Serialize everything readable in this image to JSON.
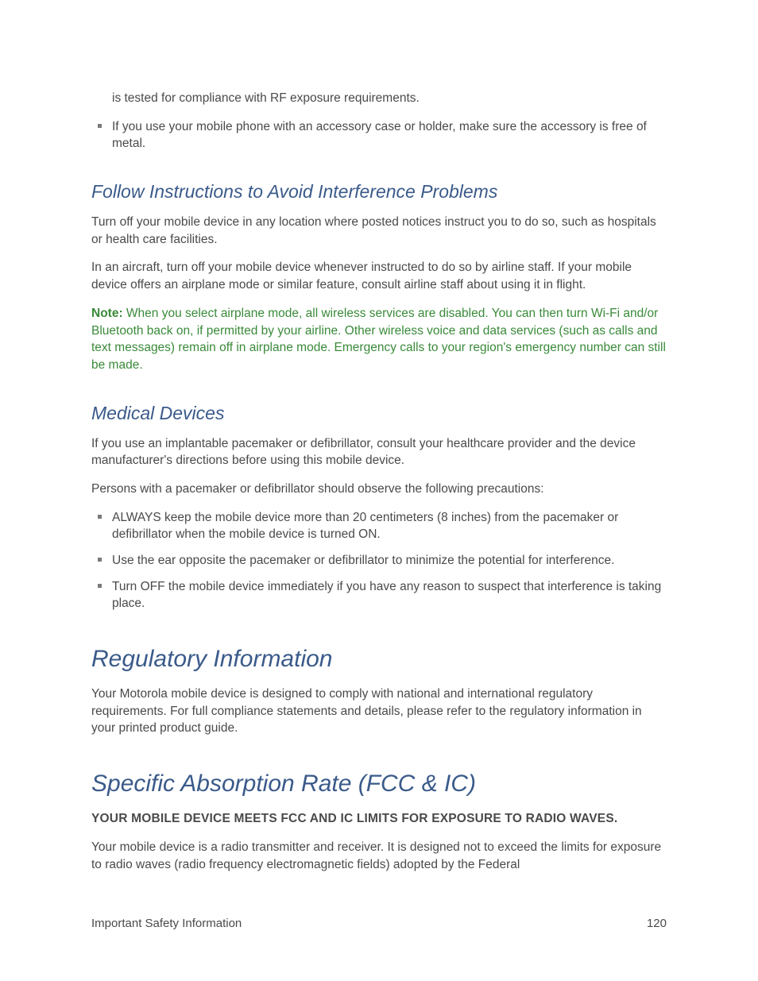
{
  "intro": {
    "continued_line": "is tested for compliance with RF exposure requirements.",
    "bullet1": "If you use your mobile phone with an accessory case or holder, make sure the accessory is free of metal."
  },
  "section1": {
    "heading": "Follow Instructions to Avoid Interference Problems",
    "p1": "Turn off your mobile device in any location where posted notices instruct you to do so, such as hospitals or health care facilities.",
    "p2": "In an aircraft, turn off your mobile device whenever instructed to do so by airline staff. If your mobile device offers an airplane mode or similar feature, consult airline staff about using it in flight.",
    "note_label": "Note:",
    "note_text": "When you select airplane mode, all wireless services are disabled. You can then turn Wi-Fi and/or Bluetooth back on, if permitted by your airline. Other wireless voice and data services (such as calls and text messages) remain off in airplane mode. Emergency calls to your region's emergency number can still be made."
  },
  "section2": {
    "heading": "Medical Devices",
    "p1": "If you use an implantable pacemaker or defibrillator, consult your healthcare provider and the device manufacturer's directions before using this mobile device.",
    "p2": "Persons with a pacemaker or defibrillator should observe the following precautions:",
    "bullets": [
      "ALWAYS keep the mobile device more than 20 centimeters (8 inches) from the pacemaker or defibrillator when the mobile device is turned ON.",
      "Use the ear opposite the pacemaker or defibrillator to minimize the potential for interference.",
      "Turn OFF the mobile device immediately if you have any reason to suspect that interference is taking place."
    ]
  },
  "section3": {
    "heading": "Regulatory Information",
    "p1": "Your Motorola mobile device is designed to comply with national and international regulatory requirements. For full compliance statements and details, please refer to the regulatory information in your printed product guide."
  },
  "section4": {
    "heading": "Specific Absorption Rate (FCC & IC)",
    "bold_line": "YOUR MOBILE DEVICE MEETS FCC AND IC LIMITS FOR EXPOSURE TO RADIO WAVES.",
    "p1": "Your mobile device is a radio transmitter and receiver. It is designed not to exceed the limits for exposure to radio waves (radio frequency electromagnetic fields) adopted by the Federal"
  },
  "footer": {
    "left": "Important Safety Information",
    "right": "120"
  }
}
